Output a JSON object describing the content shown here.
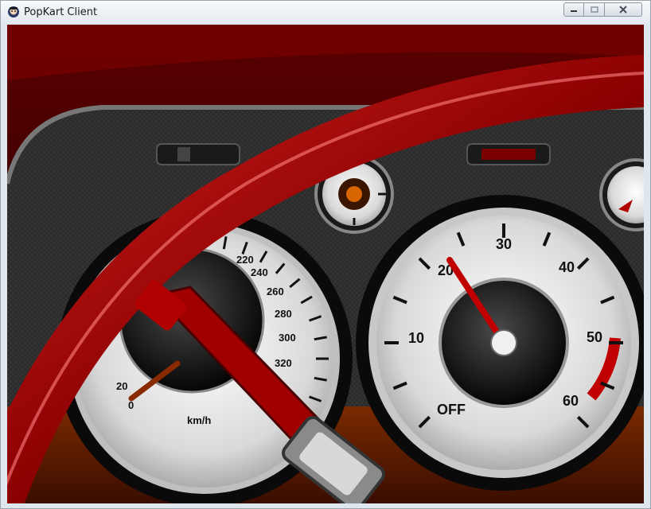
{
  "window": {
    "title": "PopKart Client",
    "app_icon": "popkart-app-icon",
    "controls": {
      "minimize_icon": "minimize-icon",
      "maximize_icon": "maximize-icon",
      "close_icon": "close-icon"
    }
  },
  "dashboard": {
    "speedometer": {
      "unit": "km/h",
      "tick_labels": [
        "0",
        "20",
        "220",
        "240",
        "260",
        "280",
        "300",
        "320"
      ],
      "needle_color": "#8a2a00"
    },
    "fuel_gauge": {
      "tick_labels": [
        "OFF",
        "10",
        "20",
        "30",
        "40",
        "50",
        "60"
      ],
      "needle_value": "20",
      "redline_color": "#c00000"
    },
    "steering_wheel_color": "#a00000"
  }
}
